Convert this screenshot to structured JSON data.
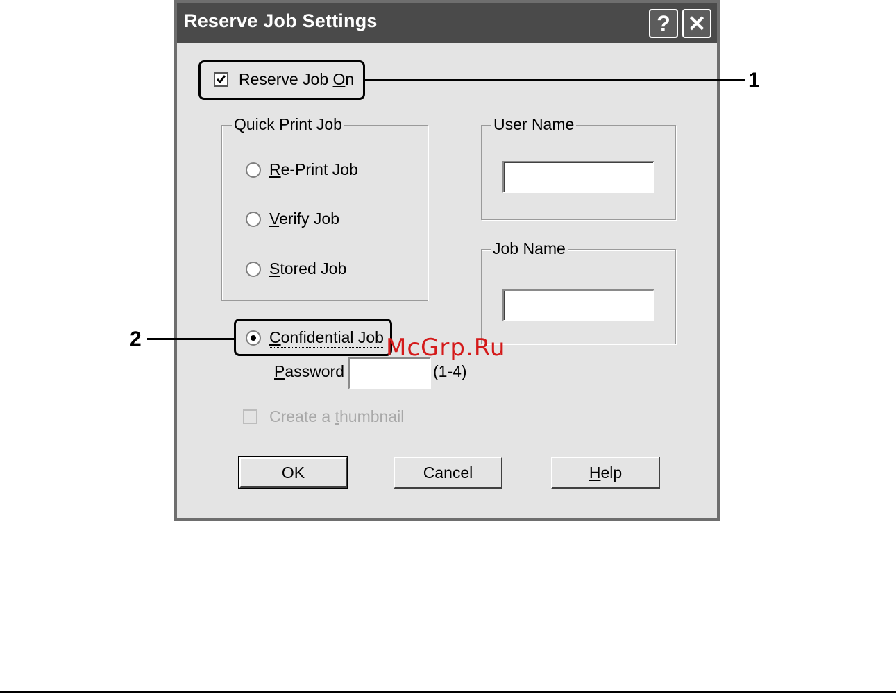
{
  "window": {
    "title": "Reserve Job Settings",
    "help_button": "?",
    "close_button": "✕"
  },
  "reserve_job": {
    "label_prefix": "Reserve Job ",
    "label_accel": "O",
    "label_suffix": "n",
    "checked": true
  },
  "quick_print_group": {
    "title": "Quick Print Job",
    "options": [
      {
        "accel": "R",
        "rest": "e-Print Job",
        "selected": false
      },
      {
        "accel": "V",
        "rest": "erify Job",
        "selected": false
      },
      {
        "accel": "S",
        "rest": "tored Job",
        "selected": false
      }
    ]
  },
  "user_name_group": {
    "title": "User Name",
    "value": ""
  },
  "job_name_group": {
    "title": "Job Name",
    "value": ""
  },
  "confidential_job": {
    "accel": "C",
    "rest": "onfidential Job",
    "selected": true
  },
  "password": {
    "accel": "P",
    "rest": "assword",
    "value": "",
    "hint": "(1-4)"
  },
  "thumbnail": {
    "prefix": "Create a ",
    "accel": "t",
    "rest": "humbnail",
    "checked": false,
    "enabled": false
  },
  "buttons": {
    "ok": "OK",
    "cancel": "Cancel",
    "help_accel": "H",
    "help_rest": "elp"
  },
  "callouts": {
    "one": "1",
    "two": "2"
  },
  "watermark": "McGrp.Ru"
}
